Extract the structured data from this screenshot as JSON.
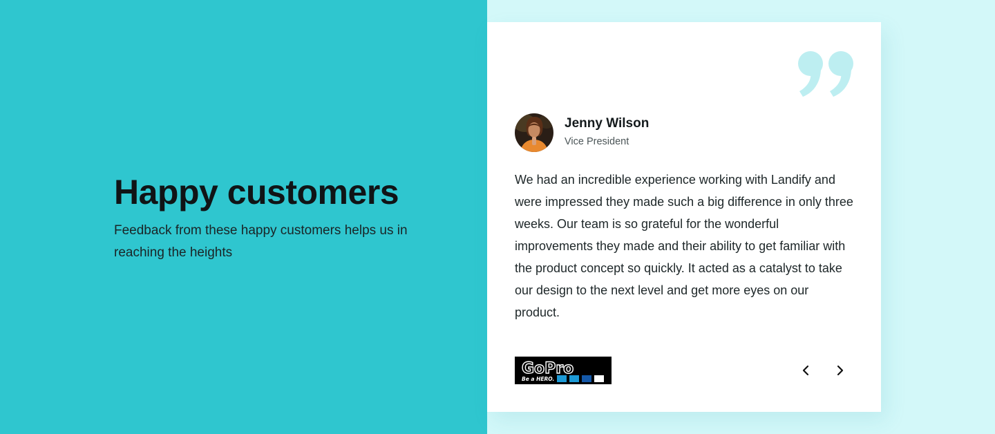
{
  "section": {
    "heading": "Happy customers",
    "subtext": "Feedback from these happy customers helps us in reaching the heights"
  },
  "testimonial": {
    "author_name": "Jenny Wilson",
    "author_title": "Vice President",
    "quote": "We had an incredible experience working with Landify and were impressed they made such a big difference in only three weeks. Our team is so grateful for the wonderful improvements they made and their ability to get familiar with the product concept so quickly. It acted as a catalyst to take our design to the next level and get more eyes on our product.",
    "company_logo": {
      "wordmark": "GoPro",
      "tagline": "Be a HERO."
    },
    "quote_icon": "closing-quote-icon",
    "prev_icon": "chevron-left-icon",
    "next_icon": "chevron-right-icon"
  },
  "colors": {
    "left_background": "#2fc6cf",
    "right_background": "#d3f8f9",
    "quote_mark": "#bdeef1",
    "heading_text": "#101416"
  }
}
